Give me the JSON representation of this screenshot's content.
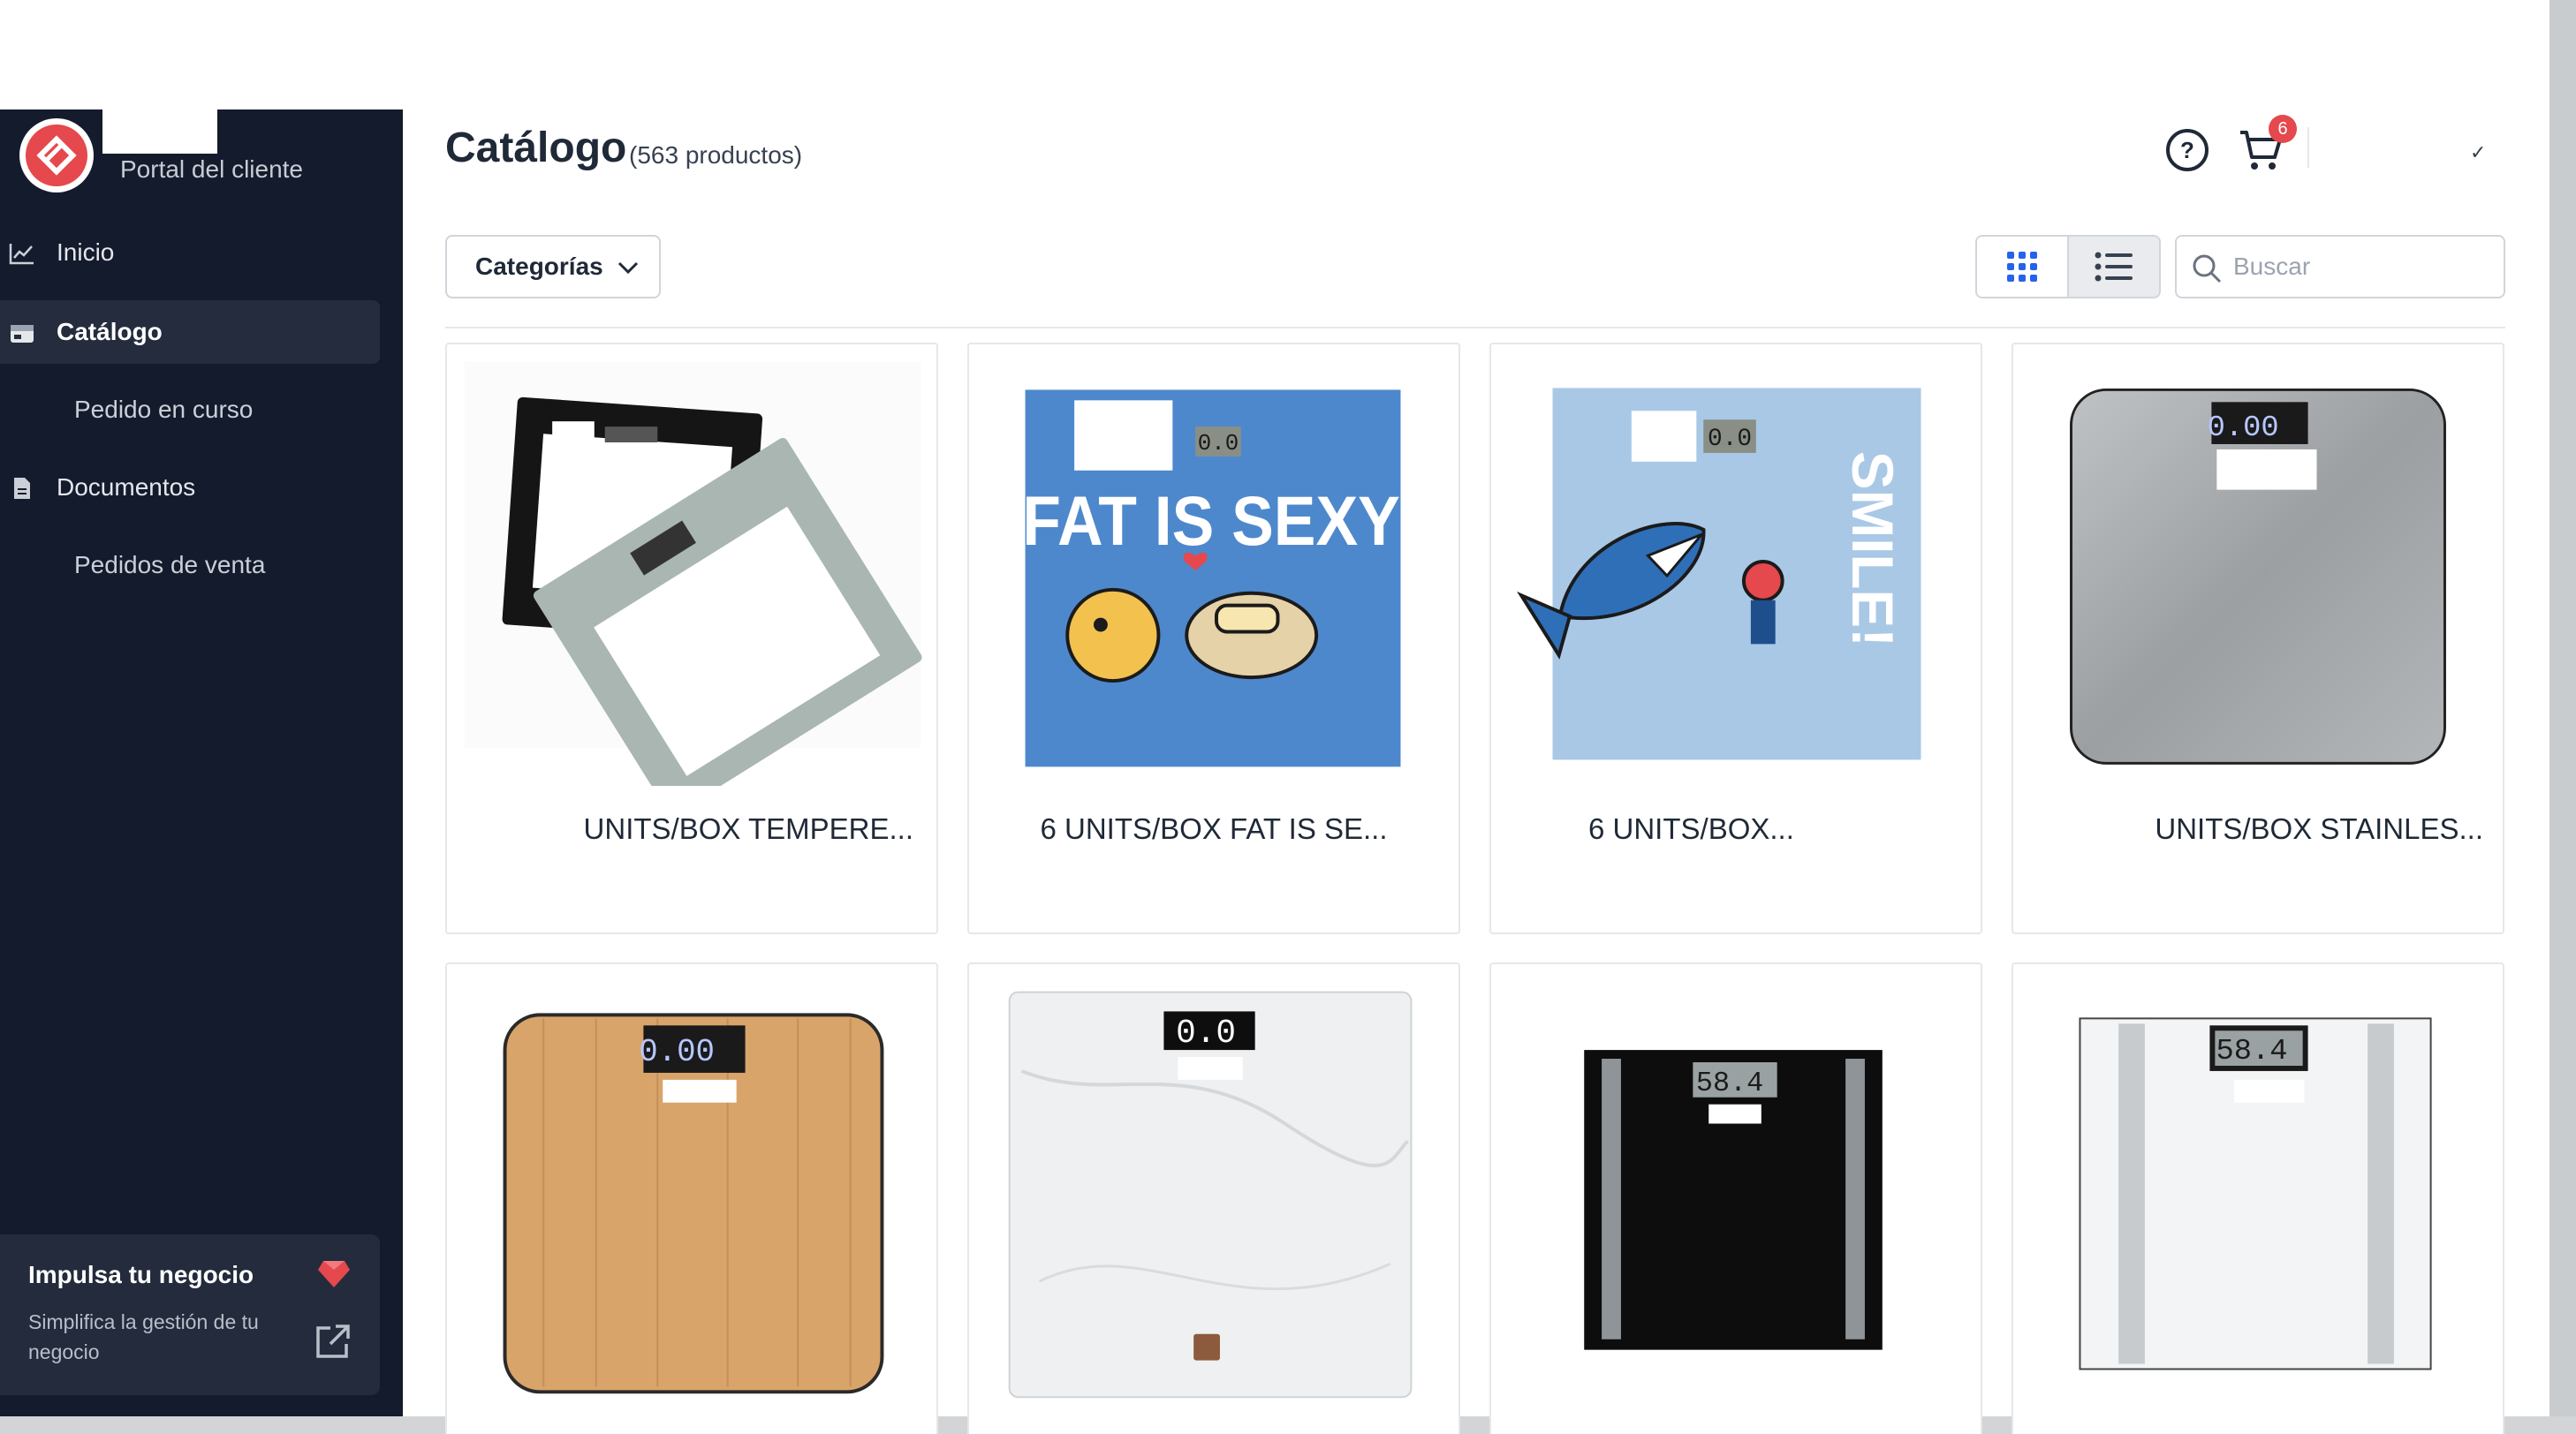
{
  "sidebar": {
    "portal_title": "Portal del cliente",
    "items": [
      {
        "label": "Inicio",
        "icon": "chart-line-icon",
        "active": false,
        "sub": false
      },
      {
        "label": "Catálogo",
        "icon": "storefront-icon",
        "active": true,
        "sub": false
      },
      {
        "label": "Pedido en curso",
        "icon": "",
        "active": false,
        "sub": true
      },
      {
        "label": "Documentos",
        "icon": "document-icon",
        "active": false,
        "sub": false
      },
      {
        "label": "Pedidos de venta",
        "icon": "",
        "active": false,
        "sub": true
      }
    ],
    "promo": {
      "title": "Impulsa tu negocio",
      "text": "Simplifica la gestión de tu negocio"
    }
  },
  "header": {
    "title": "Catálogo",
    "count": "(563 productos)",
    "cart_count": "6",
    "user_chevron": "✓"
  },
  "toolbar": {
    "categories_label": "Categorías",
    "search_placeholder": "Buscar"
  },
  "colors": {
    "sidebar_bg": "#141b2d",
    "accent_red": "#e5484d",
    "grid_icon_blue": "#2563eb"
  },
  "products": [
    {
      "name": "UNITS/BOX TEMPERE...",
      "image": "black-and-grey-glass-scales"
    },
    {
      "name": "6 UNITS/BOX FAT IS SE...",
      "image": "blue-scale-fat-is-sexy"
    },
    {
      "name": "6 UNITS/BOX...",
      "image": "light-blue-scale-shark-smile"
    },
    {
      "name": "UNITS/BOX STAINLES...",
      "image": "stainless-steel-scale"
    },
    {
      "name": "",
      "image": "wood-scale"
    },
    {
      "name": "",
      "image": "marble-scale"
    },
    {
      "name": "",
      "image": "black-body-fat-scale"
    },
    {
      "name": "",
      "image": "white-body-fat-scale"
    }
  ],
  "product_texts": {
    "fat_is_sexy": "FAT IS SEXY",
    "smile": "SMILE!",
    "lcd_zero": "0.0",
    "lcd_zero_double": "0.00",
    "lcd_weight": "58.4"
  }
}
